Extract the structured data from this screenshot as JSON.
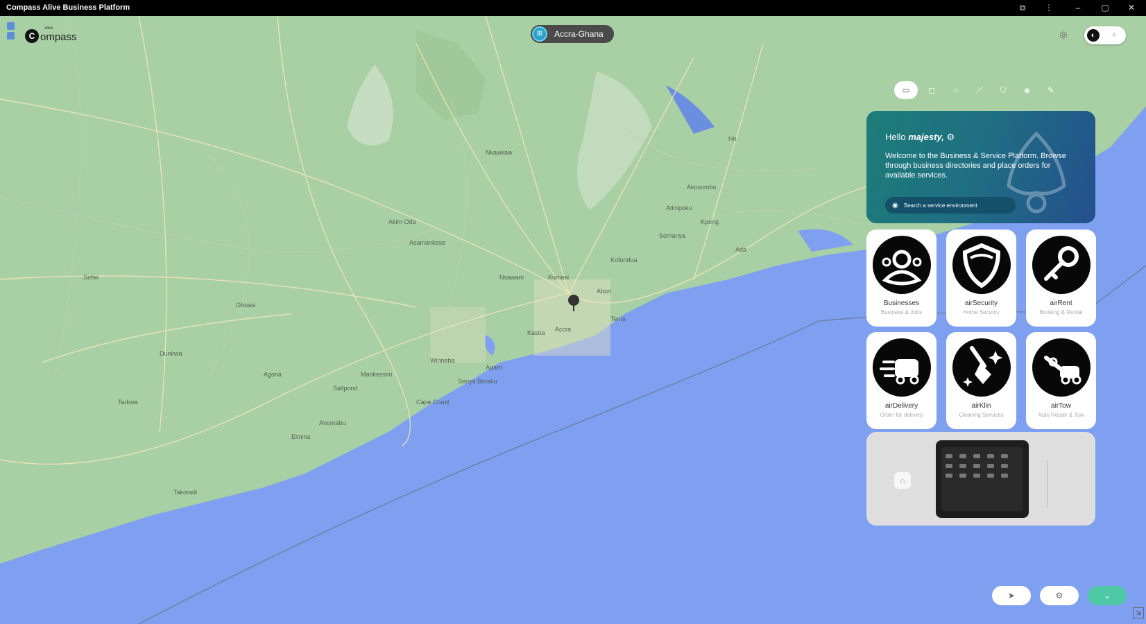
{
  "window": {
    "title": "Compass Alive Business Platform"
  },
  "titlebar": {
    "icons": [
      "puzzle-icon",
      "kebab-icon",
      "minimize-icon",
      "maximize-icon",
      "close-icon"
    ]
  },
  "logo": {
    "word": "ompass",
    "mark": "C",
    "sup": "alive"
  },
  "location": {
    "label": "Accra-Ghana",
    "icon_char": "⊞"
  },
  "map": {
    "labels": [
      "Kumasi",
      "Koforidua",
      "Nkawkaw",
      "Akim Oda",
      "Kasoa",
      "Accra",
      "Tema",
      "Winneba",
      "Cape Coast",
      "Takoradi",
      "Ho",
      "Ada",
      "Somanya",
      "Agona",
      "Saltpond",
      "Elmina",
      "Dunkwa",
      "Obuasi",
      "Asamankese",
      "Aburi",
      "Nsawam",
      "Akosombo",
      "Atimpoku",
      "Kpong",
      "Mankessim",
      "Anomabu",
      "Apam",
      "Senya Beraku",
      "Sefwi",
      "Tarkwa"
    ]
  },
  "toolbar": {
    "tools": [
      {
        "name": "select-tool",
        "char": "▭"
      },
      {
        "name": "rectangle-tool",
        "char": "◻"
      },
      {
        "name": "circle-tool",
        "char": "○"
      },
      {
        "name": "line-tool",
        "char": "⟋"
      },
      {
        "name": "polygon-tool",
        "char": "⛉"
      },
      {
        "name": "layers-tool",
        "char": "◈"
      },
      {
        "name": "pencil-tool",
        "char": "✎"
      }
    ]
  },
  "welcome": {
    "hello": "Hello",
    "user": "majesty,",
    "body": "Welcome to the Business & Service Platform. Browse through business directories and place orders for available services.",
    "search_label": "Search a service environment"
  },
  "tiles": [
    {
      "name": "Businesses",
      "sub": "Business & Jobs",
      "icon": "businesses-icon"
    },
    {
      "name": "airSecurity",
      "sub": "Home Security",
      "icon": "security-shield-icon"
    },
    {
      "name": "airRent",
      "sub": "Booking & Rental",
      "icon": "key-icon"
    },
    {
      "name": "airDelivery",
      "sub": "Order for delivery",
      "icon": "delivery-truck-icon"
    },
    {
      "name": "airKlin",
      "sub": "Cleaning Services",
      "icon": "cleaning-icon"
    },
    {
      "name": "airTow",
      "sub": "Auto Repair & Tow",
      "icon": "tow-truck-icon"
    }
  ],
  "promo": {
    "icon": "home-icon"
  },
  "bottom": {
    "buttons": [
      {
        "name": "locate-button",
        "char": "➤"
      },
      {
        "name": "settings-button",
        "char": "⚙"
      },
      {
        "name": "expand-button",
        "char": "⌄"
      }
    ]
  },
  "colors": {
    "sea": "#7f9ff0",
    "land": "#a9cfa4",
    "accent": "#1e7d78",
    "expand": "#4fc9a5"
  }
}
